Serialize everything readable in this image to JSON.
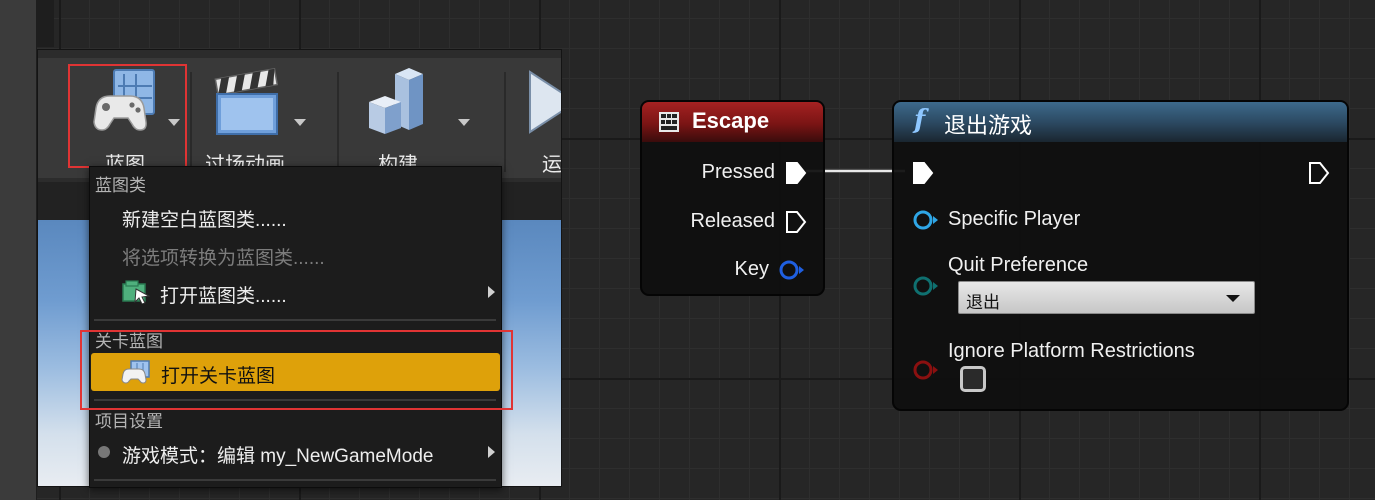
{
  "toolbar": {
    "buttons": [
      {
        "label": "蓝图",
        "icon": "gamepad-blueprint-icon"
      },
      {
        "label": "过场动画",
        "icon": "clapperboard-icon"
      },
      {
        "label": "构建",
        "icon": "building-blocks-icon"
      },
      {
        "label": "运",
        "icon": "play-icon"
      }
    ]
  },
  "menu": {
    "section_blueprint_class": "蓝图类",
    "new_empty_blueprint": "新建空白蓝图类......",
    "convert_selection": "将选项转换为蓝图类......",
    "open_blueprint_class": "打开蓝图类......",
    "section_level_blueprint": "关卡蓝图",
    "open_level_blueprint": "打开关卡蓝图",
    "section_project_settings": "项目设置",
    "game_mode": "游戏模式：编辑 my_NewGameMode"
  },
  "escape_node": {
    "title": "Escape",
    "pins": [
      "Pressed",
      "Released",
      "Key"
    ]
  },
  "quit_node": {
    "title": "退出游戏",
    "function_symbol": "f",
    "specific_player": "Specific Player",
    "quit_preference": "Quit Preference",
    "quit_preference_value": "退出",
    "ignore_restrictions": "Ignore Platform Restrictions",
    "ignore_restrictions_checked": false
  },
  "colors": {
    "menu_highlight": "#dea10a",
    "red_outline": "#e03434",
    "escape_header": "#8b1a1a",
    "quit_header": "#2c4a63",
    "object_pin": "#2fa6e6",
    "enum_pin": "#0f7070",
    "bool_pin": "#8b1010"
  }
}
